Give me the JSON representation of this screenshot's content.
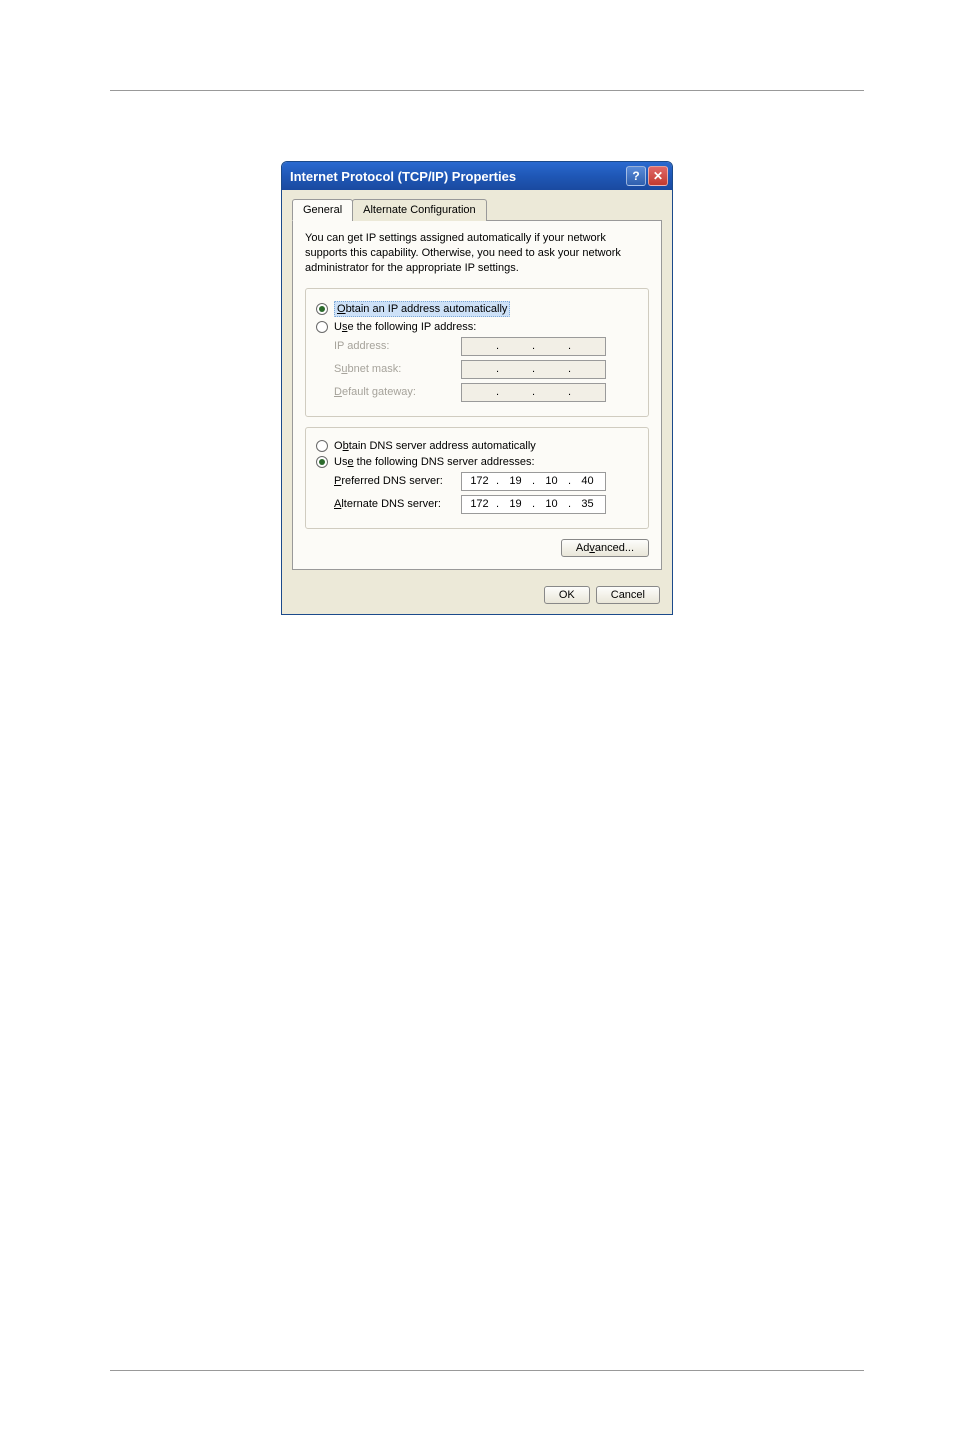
{
  "dialog": {
    "title": "Internet Protocol (TCP/IP) Properties",
    "tabs": {
      "general": "General",
      "alternate": "Alternate Configuration"
    },
    "blurb": "You can get IP settings assigned automatically if your network supports this capability. Otherwise, you need to ask your network administrator for the appropriate IP settings.",
    "radios": {
      "obtain_ip": "Obtain an IP address automatically",
      "use_ip": "Use the following IP address:",
      "obtain_dns": "Obtain DNS server address automatically",
      "use_dns": "Use the following DNS server addresses:"
    },
    "labels": {
      "ip_address": "IP address:",
      "subnet_mask": "Subnet mask:",
      "default_gateway": "Default gateway:",
      "preferred_dns": "Preferred DNS server:",
      "alternate_dns": "Alternate DNS server:"
    },
    "values": {
      "preferred_dns": {
        "a": "172",
        "b": "19",
        "c": "10",
        "d": "40"
      },
      "alternate_dns": {
        "a": "172",
        "b": "19",
        "c": "10",
        "d": "35"
      }
    },
    "buttons": {
      "advanced": "Advanced...",
      "ok": "OK",
      "cancel": "Cancel"
    },
    "accel": {
      "obtain_ip": "O",
      "use_ip": "s",
      "obtain_dns": "b",
      "use_dns": "e",
      "preferred_dns": "P",
      "alternate_dns": "A",
      "advanced": "v",
      "default_gateway": "D",
      "subnet_mask": "u"
    }
  }
}
